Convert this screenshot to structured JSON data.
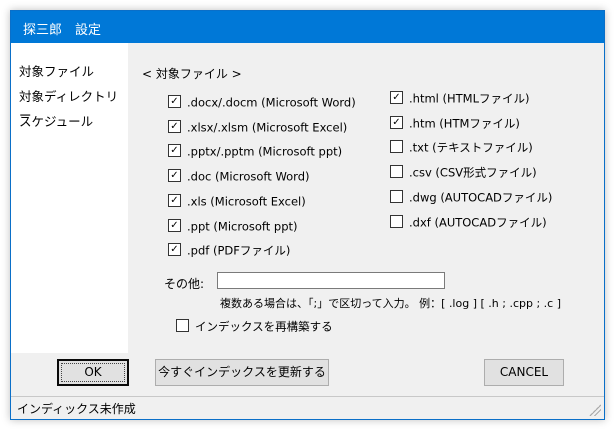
{
  "window": {
    "title": "探三郎　設定"
  },
  "sidebar": {
    "items": [
      {
        "label": "対象ファイル"
      },
      {
        "label": "対象ディレクトリー"
      },
      {
        "label": "スケジュール"
      }
    ]
  },
  "panel": {
    "section_label": "< 対象ファイル >",
    "left_checks": [
      {
        "label": ".docx/.docm (Microsoft Word)",
        "checked": true
      },
      {
        "label": ".xlsx/.xlsm (Microsoft Excel)",
        "checked": true
      },
      {
        "label": ".pptx/.pptm (Microsoft ppt)",
        "checked": true
      },
      {
        "label": ".doc (Microsoft Word)",
        "checked": true
      },
      {
        "label": ".xls (Microsoft Excel)",
        "checked": true
      },
      {
        "label": ".ppt (Microsoft ppt)",
        "checked": true
      },
      {
        "label": ".pdf (PDFファイル)",
        "checked": true
      }
    ],
    "right_checks": [
      {
        "label": ".html (HTMLファイル)",
        "checked": true
      },
      {
        "label": ".htm (HTMファイル)",
        "checked": true
      },
      {
        "label": ".txt (テキストファイル)",
        "checked": false
      },
      {
        "label": ".csv (CSV形式ファイル)",
        "checked": false
      },
      {
        "label": ".dwg (AUTOCADファイル)",
        "checked": false
      },
      {
        "label": ".dxf (AUTOCADファイル)",
        "checked": false
      }
    ],
    "other_label": "その他:",
    "other_value": "",
    "hint": "複数ある場合は、「;」で区切って入力。 例：[ .log ] [ .h ; .cpp ; .c ]",
    "rebuild": {
      "label": "インデックスを再構築する",
      "checked": false
    }
  },
  "buttons": {
    "ok": "OK",
    "update": "今すぐインデックスを更新する",
    "cancel": "CANCEL"
  },
  "status": {
    "text": "インディックス未作成"
  }
}
